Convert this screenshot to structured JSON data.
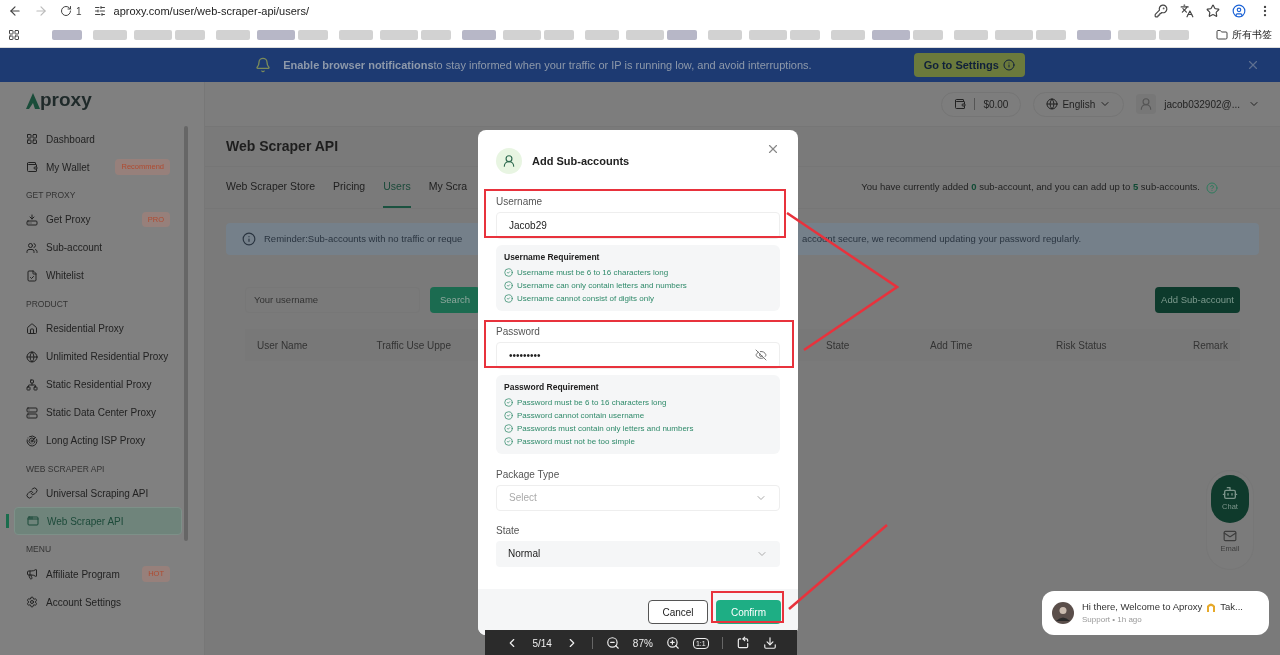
{
  "browser": {
    "tab_count": "1",
    "url": "aproxy.com/user/web-scraper-api/users/",
    "bookmarks_folder": "所有书签"
  },
  "notification": {
    "bold_text": "Enable browser notifications",
    "text": "to stay informed when your traffic or IP is running low, and avoid interruptions.",
    "button": "Go to Settings"
  },
  "sidebar": {
    "logo": "proxy",
    "sections": [
      {
        "items": [
          {
            "label": "Dashboard",
            "selected": false
          },
          {
            "label": "My Wallet",
            "badge": "Recommend",
            "selected": false
          }
        ]
      },
      {
        "heading": "GET PROXY",
        "items": [
          {
            "label": "Get Proxy",
            "badge": "PRO",
            "selected": false
          },
          {
            "label": "Sub-account",
            "selected": false
          },
          {
            "label": "Whitelist",
            "selected": false
          }
        ]
      },
      {
        "heading": "PRODUCT",
        "items": [
          {
            "label": "Residential Proxy",
            "selected": false
          },
          {
            "label": "Unlimited Residential Proxy",
            "selected": false
          },
          {
            "label": "Static Residential Proxy",
            "selected": false
          },
          {
            "label": "Static Data Center Proxy",
            "selected": false
          },
          {
            "label": "Long Acting ISP Proxy",
            "selected": false
          }
        ]
      },
      {
        "heading": "WEB SCRAPER API",
        "items": [
          {
            "label": "Universal Scraping API",
            "selected": false
          },
          {
            "label": "Web Scraper API",
            "selected": true
          }
        ]
      },
      {
        "heading": "MENU",
        "items": [
          {
            "label": "Affiliate Program",
            "badge": "HOT",
            "selected": false
          },
          {
            "label": "Account Settings",
            "selected": false
          }
        ]
      }
    ]
  },
  "header": {
    "balance": "$0.00",
    "language": "English",
    "user": "jacob032902@..."
  },
  "page": {
    "title": "Web Scraper API",
    "tabs": [
      {
        "label": "Web Scraper Store",
        "selected": false
      },
      {
        "label": "Pricing",
        "selected": false
      },
      {
        "label": "Users",
        "selected": true
      },
      {
        "label": "My Scra",
        "selected": false
      }
    ],
    "quota": {
      "prefix": "You have currently added ",
      "added": "0",
      "middle": " sub-account, and you can add up to ",
      "max": "5",
      "suffix": " sub-accounts."
    },
    "reminder_left": "Reminder:Sub-accounts with no traffic or reque",
    "reminder_right": "account secure, we recommend updating your password regularly.",
    "search": {
      "placeholder": "Your username",
      "button": "Search"
    },
    "add_button": "Add Sub-account",
    "table": {
      "columns_left": [
        "User Name",
        "Traffic Use Uppe"
      ],
      "columns_right": [
        "State",
        "Add Time",
        "Risk Status",
        "Remark"
      ]
    }
  },
  "modal": {
    "title": "Add Sub-accounts",
    "username": {
      "label": "Username",
      "value": "Jacob29"
    },
    "username_requirement": {
      "title": "Username Requirement",
      "rules": [
        {
          "text": "Username must be 6 to 16 characters long",
          "met": true
        },
        {
          "text": "Username can only contain letters and numbers",
          "met": true
        },
        {
          "text": "Username cannot consist of digits only",
          "met": true
        }
      ]
    },
    "password": {
      "label": "Password",
      "value": "•••••••••"
    },
    "password_requirement": {
      "title": "Password Requirement",
      "rules": [
        {
          "text": "Password must be 6 to 16 characters long",
          "met": true
        },
        {
          "text": "Password cannot contain username",
          "met": true
        },
        {
          "text": "Passwords must contain only letters and numbers",
          "met": true
        },
        {
          "text": "Password must not be too simple",
          "met": true
        }
      ]
    },
    "package_type": {
      "label": "Package Type",
      "placeholder": "Select"
    },
    "state": {
      "label": "State",
      "value": "Normal"
    },
    "cancel": "Cancel",
    "confirm": "Confirm"
  },
  "viewer": {
    "page": "5/14",
    "zoom": "87%",
    "actual_size": "1:1"
  },
  "support": {
    "chat": "Chat",
    "email": "Email",
    "message": "Hi there, Welcome to Aproxy",
    "message_tail": "Tak...",
    "meta": "Support • 1h ago"
  }
}
